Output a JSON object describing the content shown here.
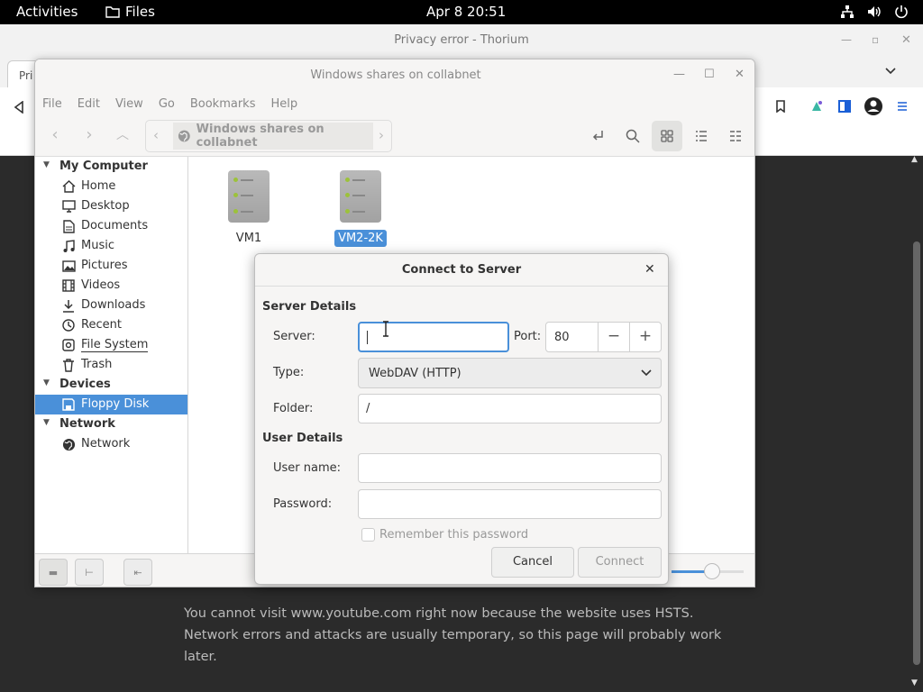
{
  "topbar": {
    "activities": "Activities",
    "app": "Files",
    "clock": "Apr 8  20:51"
  },
  "browser": {
    "title": "Privacy error - Thorium",
    "tab_label": "Pri",
    "error_text": "You cannot visit www.youtube.com right now because the website uses HSTS. Network errors and attacks are usually temporary, so this page will probably work later."
  },
  "files": {
    "title": "Windows shares on collabnet",
    "menu": [
      "File",
      "Edit",
      "View",
      "Go",
      "Bookmarks",
      "Help"
    ],
    "path": "Windows shares on collabnet",
    "sidebar": {
      "my_computer": "My Computer",
      "items": [
        {
          "label": "Home",
          "icon": "home-icon"
        },
        {
          "label": "Desktop",
          "icon": "desktop-icon"
        },
        {
          "label": "Documents",
          "icon": "documents-icon"
        },
        {
          "label": "Music",
          "icon": "music-icon"
        },
        {
          "label": "Pictures",
          "icon": "pictures-icon"
        },
        {
          "label": "Videos",
          "icon": "videos-icon"
        },
        {
          "label": "Downloads",
          "icon": "downloads-icon"
        },
        {
          "label": "Recent",
          "icon": "recent-icon"
        },
        {
          "label": "File System",
          "icon": "drive-icon"
        },
        {
          "label": "Trash",
          "icon": "trash-icon"
        }
      ],
      "devices": "Devices",
      "floppy": "Floppy Disk",
      "network_header": "Network",
      "network_item": "Network"
    },
    "servers": [
      {
        "name": "VM1",
        "selected": false
      },
      {
        "name": "VM2-2K",
        "selected": true
      }
    ]
  },
  "dialog": {
    "title": "Connect to Server",
    "server_details": "Server Details",
    "server_label": "Server:",
    "server_value": "",
    "port_label": "Port:",
    "port_value": "80",
    "type_label": "Type:",
    "type_value": "WebDAV (HTTP)",
    "folder_label": "Folder:",
    "folder_value": "/",
    "user_details": "User Details",
    "username_label": "User name:",
    "password_label": "Password:",
    "remember": "Remember this password",
    "cancel": "Cancel",
    "connect": "Connect"
  },
  "colors": {
    "accent": "#4a90d9",
    "topbar": "#000000",
    "page_bg": "#2b2b2b"
  }
}
